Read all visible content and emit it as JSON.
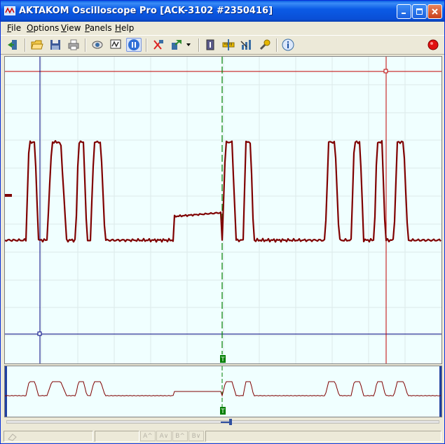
{
  "window": {
    "title": "AKTAKOM Oscilloscope Pro [ACK-3102 #2350416]",
    "controls": [
      "minimize",
      "maximize",
      "close"
    ]
  },
  "menu": [
    {
      "label": "File",
      "accel": "F",
      "rest": "ile"
    },
    {
      "label": "Options",
      "accel": "O",
      "rest": "ptions"
    },
    {
      "label": "View",
      "accel": "V",
      "rest": "iew"
    },
    {
      "label": "Panels",
      "accel": "P",
      "rest": "anels"
    },
    {
      "label": "Help",
      "accel": "H",
      "rest": "elp"
    }
  ],
  "toolbar": {
    "icons": [
      "exit-icon",
      "open-folder-icon",
      "save-icon",
      "print-icon",
      "single-shot-icon",
      "monitor-icon",
      "pause-icon",
      "cut-icon",
      "export-icon",
      "info-panel-icon",
      "ruler-icon",
      "measure-icon",
      "probe-icon",
      "about-icon",
      "record-icon"
    ]
  },
  "scope": {
    "trigger_marker": "T",
    "colors": {
      "background": "#F0FFFF",
      "trace": "#7F0000",
      "cursor_blue": "#00007F",
      "cursor_red": "#C00000",
      "trigger_green": "#007F00",
      "grid": "#D8E8E8"
    }
  },
  "mini": {
    "trigger_marker": "T"
  },
  "statusbar": {
    "buttons": [
      "A^",
      "A∨",
      "B^",
      "B∨"
    ]
  }
}
